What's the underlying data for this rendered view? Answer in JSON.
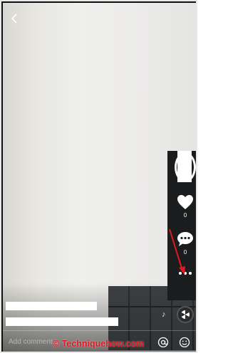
{
  "header": {
    "back_icon": "chevron-left-icon"
  },
  "actions": {
    "likes_count": "0",
    "comments_count": "0",
    "more_icon": "ellipsis-icon"
  },
  "comment_bar": {
    "placeholder": "Add comment...",
    "mention_icon": "at-sign-icon",
    "emoji_icon": "smiley-icon"
  },
  "watermark": {
    "text": "© Techniquehow.com"
  },
  "colors": {
    "arrow": "#e0181f",
    "watermark": "#e0181f"
  }
}
